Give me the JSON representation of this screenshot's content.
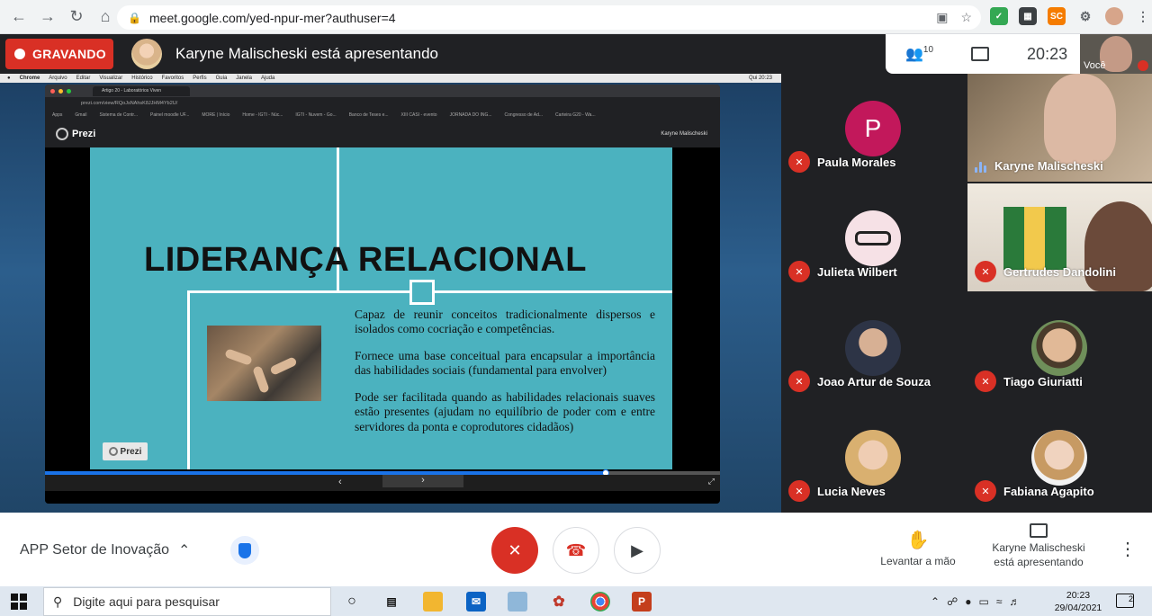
{
  "browser": {
    "url": "meet.google.com/yed-npur-mer?authuser=4"
  },
  "meet": {
    "recording_label": "GRAVANDO",
    "presenting_text": "Karyne Malischeski está apresentando",
    "people_count": "10",
    "clock": "20:23",
    "self_label": "Você",
    "meeting_name": "APP Setor de Inovação",
    "raise_hand_label": "Levantar a mão",
    "presenting_button": [
      "Karyne Malischeski",
      "está apresentando"
    ]
  },
  "shared_screen": {
    "mac_menu": [
      "Chrome",
      "Arquivo",
      "Editar",
      "Visualizar",
      "Histórico",
      "Favoritos",
      "Perfis",
      "Guia",
      "Janela",
      "Ajuda"
    ],
    "mac_clock": "Qui 20:23",
    "tab_title": "Artigo 20 - Laboratórios Viven",
    "inner_url": "prezi.com/view/RQoJsNAhsK8JJHM4Yb2U/",
    "bookmarks": [
      "Apps",
      "Gmail",
      "Sistema de Contr...",
      "Painel moodle UF...",
      "MORE | Início",
      "Home - IGTI - Núc...",
      "IGTI - Nuvem - Go...",
      "Banco de Teses e...",
      "XIII CASI - evento",
      "JORNADA DO ING...",
      "Congresso de Ad...",
      "Carteira G20 - Wa..."
    ],
    "prezi_brand": "Prezi",
    "prezi_user": "Karyne Malischeski",
    "slide": {
      "title": "LIDERANÇA RELACIONAL",
      "paragraphs": [
        "Capaz de reunir conceitos tradicionalmente dispersos e isolados como cocriação e competências.",
        "Fornece uma base conceitual para encapsular a importância das habilidades sociais (fundamental para envolver)",
        "Pode ser facilitada quando as habilidades relacionais suaves estão presentes (ajudam no equilíbrio de poder com e entre servidores da ponta e coprodutores cidadãos)"
      ],
      "badge": "Prezi",
      "progress": 0.83
    }
  },
  "participants": [
    {
      "name": "Paula Morales",
      "initial": "P",
      "avatar_color": "#c2185b"
    },
    {
      "name": "Karyne Malischeski",
      "speaking": true
    },
    {
      "name": "Julieta Wilbert"
    },
    {
      "name": "Gertrudes Dandolini"
    },
    {
      "name": "Joao Artur de Souza"
    },
    {
      "name": "Tiago Giuriatti"
    },
    {
      "name": "Lucia Neves"
    },
    {
      "name": "Fabiana Agapito"
    }
  ],
  "taskbar": {
    "search_placeholder": "Digite aqui para pesquisar",
    "time": "20:23",
    "date": "29/04/2021",
    "notifications": "2"
  },
  "colors": {
    "record_red": "#d93025",
    "slide_teal": "#4bb2bf",
    "accent_blue": "#1a73e8"
  }
}
